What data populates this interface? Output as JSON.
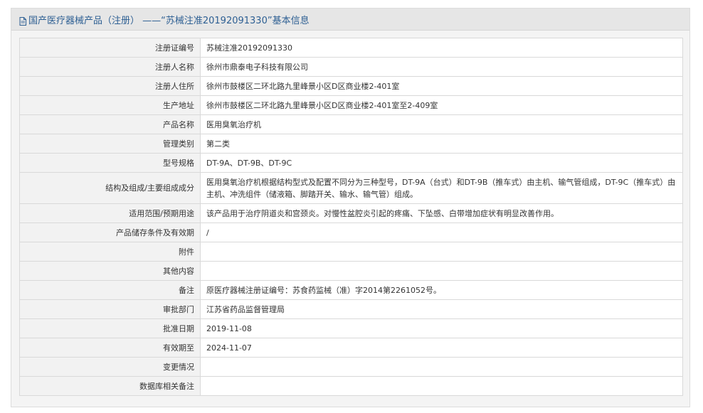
{
  "header": {
    "title": "国产医疗器械产品（注册） ——“苏械注准20192091330”基本信息",
    "icon": "document-icon"
  },
  "rows": [
    {
      "label": "注册证编号",
      "value": "苏械注准20192091330"
    },
    {
      "label": "注册人名称",
      "value": "徐州市鼎泰电子科技有限公司"
    },
    {
      "label": "注册人住所",
      "value": "徐州市鼓楼区二环北路九里峰景小区D区商业楼2-401室"
    },
    {
      "label": "生产地址",
      "value": "徐州市鼓楼区二环北路九里峰景小区D区商业楼2-401室至2-409室"
    },
    {
      "label": "产品名称",
      "value": "医用臭氧治疗机"
    },
    {
      "label": "管理类别",
      "value": "第二类"
    },
    {
      "label": "型号规格",
      "value": "DT-9A、DT-9B、DT-9C"
    },
    {
      "label": "结构及组成/主要组成成分",
      "value": "医用臭氧治疗机根据结构型式及配置不同分为三种型号，DT-9A（台式）和DT-9B（推车式）由主机、输气管组成，DT-9C（推车式）由主机、冲洗组件（储液箱、脚踏开关、输水、输气管）组成。"
    },
    {
      "label": "适用范围/预期用途",
      "value": "该产品用于治疗阴道炎和宫颈炎。对慢性盆腔炎引起的疼痛、下坠感、白带增加症状有明显改善作用。"
    },
    {
      "label": "产品储存条件及有效期",
      "value": "/"
    },
    {
      "label": "附件",
      "value": ""
    },
    {
      "label": "其他内容",
      "value": ""
    },
    {
      "label": "备注",
      "value": "原医疗器械注册证编号：苏食药监械（准）字2014第2261052号。"
    },
    {
      "label": "审批部门",
      "value": "江苏省药品监督管理局"
    },
    {
      "label": "批准日期",
      "value": "2019-11-08"
    },
    {
      "label": "有效期至",
      "value": "2024-11-07"
    },
    {
      "label": "变更情况",
      "value": ""
    },
    {
      "label": "数据库相关备注",
      "value": ""
    }
  ],
  "colors": {
    "title": "#2d5f93",
    "label_bg": "#f2f2f2",
    "border": "#d9d9d9",
    "header_bg": "#e6e6e6"
  }
}
